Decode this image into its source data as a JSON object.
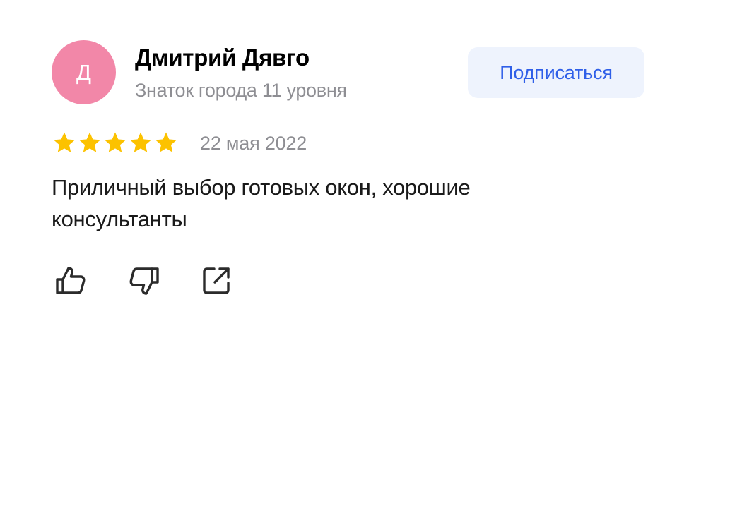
{
  "author": {
    "avatar_letter": "Д",
    "avatar_color": "#f287a8",
    "name": "Дмитрий Дявго",
    "level": "Знаток города 11 уровня"
  },
  "subscribe": {
    "label": "Подписаться",
    "text_color": "#2f5fe8",
    "background": "#eef3fd"
  },
  "review": {
    "rating": 5,
    "max_rating": 5,
    "star_color": "#fcc200",
    "date": "22 мая 2022",
    "text": "Приличный выбор готовых окон, хорошие консультанты"
  },
  "actions": [
    {
      "icon": "thumbs-up-icon"
    },
    {
      "icon": "thumbs-down-icon"
    },
    {
      "icon": "share-icon"
    }
  ]
}
